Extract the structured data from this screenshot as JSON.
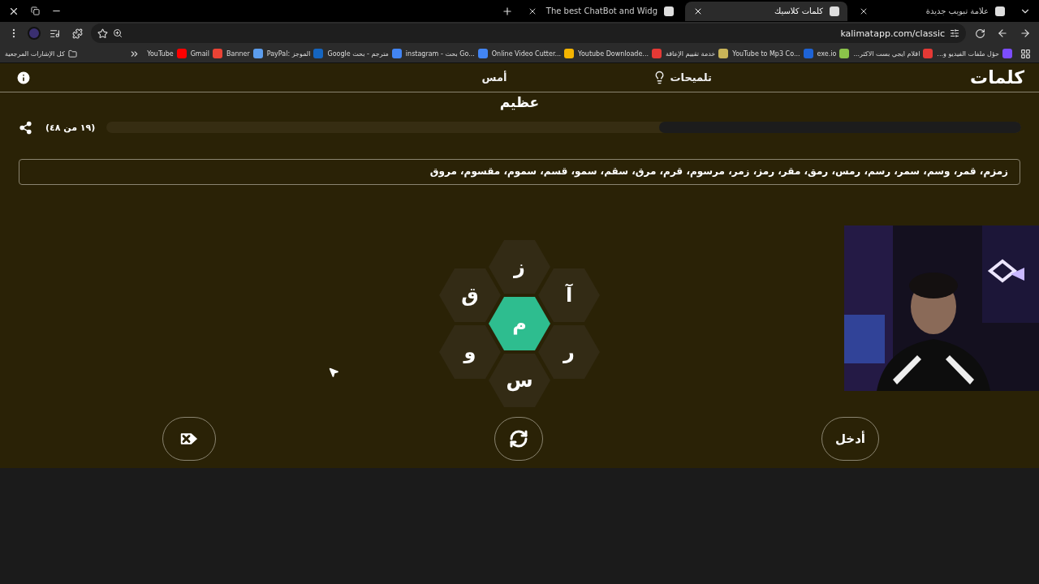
{
  "browser": {
    "tabs": [
      {
        "title": "علامة تبويب جديدة",
        "selected": false
      },
      {
        "title": "كلمات كلاسيك",
        "selected": true
      },
      {
        "title": "The best ChatBot and Widg",
        "selected": false
      }
    ],
    "url": "kalimatapp.com/classic",
    "bookmarks": [
      {
        "title": "حؤل ملفات الفيديو و...",
        "color": "#7c4dff"
      },
      {
        "title": "اقلام ايجي بست الاكثر...",
        "color": "#e53935"
      },
      {
        "title": "exe.io",
        "color": "#8bc34a"
      },
      {
        "title": "YouTube to Mp3 Co...",
        "color": "#1e63d6"
      },
      {
        "title": "خدمة تقييم الإعاقة",
        "color": "#c9b458"
      },
      {
        "title": "Youtube Downloade...",
        "color": "#e53935"
      },
      {
        "title": "Online Video Cutter...",
        "color": "#f4b400"
      },
      {
        "title": "instagram - بحث Go...",
        "color": "#4285f4"
      },
      {
        "title": "مترجم - بحث Google",
        "color": "#4285f4"
      },
      {
        "title": "PayPal: الموجز",
        "color": "#1565c0"
      },
      {
        "title": "Banner",
        "color": "#5c9ded"
      },
      {
        "title": "Gmail",
        "color": "#ea4335"
      },
      {
        "title": "YouTube",
        "color": "#ff0000"
      }
    ],
    "all_bookmarks": "كل الإشارات المرجعية"
  },
  "game": {
    "logo": "كلمات",
    "hints": "تلميحات",
    "yesterday": "أمس",
    "rank": "عظيم",
    "score": "(١٩ من ٤٨)",
    "progress": {
      "level": 0.396
    },
    "found_words": "زمزم، قمر، وسم، سمر، رسم، رمس، رمق، مقر، رمز، زمر، مرسوم، قرم، مرق، سقم، سمو، قسم، سموم، مقسوم، مروق",
    "center_letter": "م",
    "outer_letters": [
      "ز",
      "آ",
      "ر",
      "س",
      "و",
      "ق"
    ],
    "enter": "أدخل"
  }
}
